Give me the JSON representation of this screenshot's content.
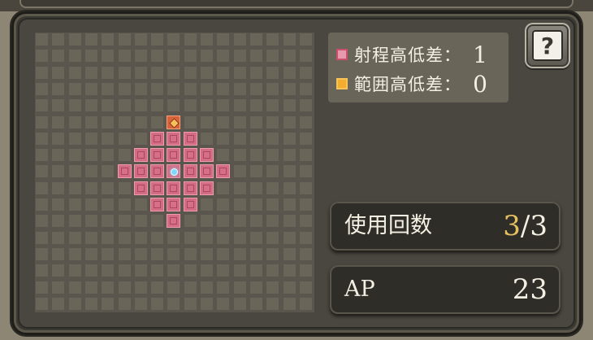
{
  "legend": {
    "range_height_label": "射程高低差：",
    "range_height_value": "1",
    "area_height_label": "範囲高低差：",
    "area_height_value": "0",
    "colors": {
      "range": "#d26d84",
      "area": "#f2ad2f"
    }
  },
  "help": {
    "icon": "help-book-icon",
    "symbol": "?"
  },
  "uses": {
    "label": "使用回数",
    "current": "3",
    "separator": "/",
    "max": "3"
  },
  "ap": {
    "label": "AP",
    "value": "23"
  },
  "range_grid": {
    "columns": 17,
    "rows": 17,
    "origin": [
      8,
      8
    ],
    "target": [
      8,
      5
    ],
    "range_cells": [
      [
        8,
        5
      ],
      [
        7,
        6
      ],
      [
        8,
        6
      ],
      [
        9,
        6
      ],
      [
        6,
        7
      ],
      [
        7,
        7
      ],
      [
        8,
        7
      ],
      [
        9,
        7
      ],
      [
        10,
        7
      ],
      [
        5,
        8
      ],
      [
        6,
        8
      ],
      [
        7,
        8
      ],
      [
        8,
        8
      ],
      [
        9,
        8
      ],
      [
        10,
        8
      ],
      [
        11,
        8
      ],
      [
        6,
        9
      ],
      [
        7,
        9
      ],
      [
        8,
        9
      ],
      [
        9,
        9
      ],
      [
        10,
        9
      ],
      [
        7,
        10
      ],
      [
        8,
        10
      ],
      [
        9,
        10
      ],
      [
        8,
        11
      ]
    ]
  }
}
